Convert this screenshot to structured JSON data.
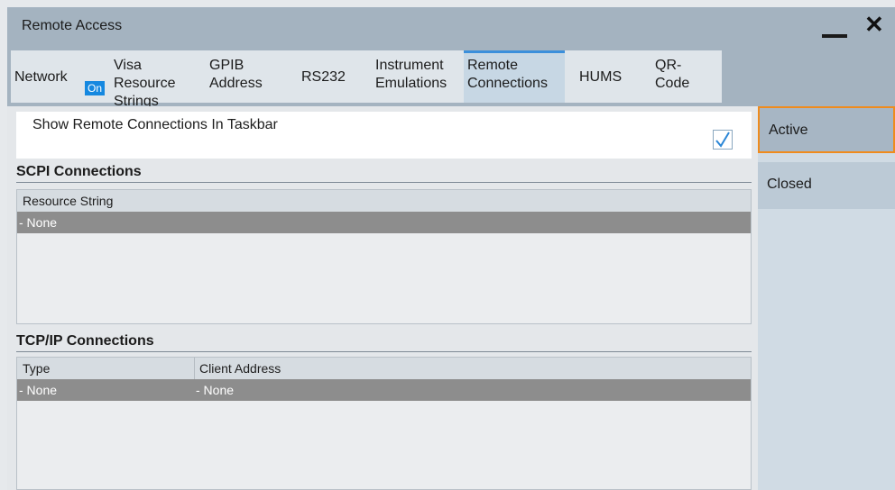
{
  "window": {
    "title": "Remote Access"
  },
  "tabs": [
    {
      "label": "Network",
      "badge": "On"
    },
    {
      "label": "Visa Resource\nStrings"
    },
    {
      "label": "GPIB\nAddress"
    },
    {
      "label": "RS232"
    },
    {
      "label": "Instrument\nEmulations"
    },
    {
      "label": "Remote\nConnections",
      "active": true
    },
    {
      "label": "HUMS"
    },
    {
      "label": "QR-\nCode"
    }
  ],
  "show_taskbar": {
    "label": "Show Remote Connections In Taskbar",
    "checked": true
  },
  "scpi": {
    "title": "SCPI Connections",
    "columns": [
      "Resource String"
    ],
    "rows": [
      [
        "- None"
      ]
    ]
  },
  "tcpip": {
    "title": "TCP/IP Connections",
    "columns": [
      "Type",
      "Client Address"
    ],
    "rows": [
      [
        "- None",
        "- None"
      ]
    ]
  },
  "side": {
    "active_label": "Active",
    "closed_label": "Closed",
    "selected": "Active"
  },
  "colors": {
    "accent": "#3b8fdb",
    "badge": "#1588e0",
    "focus": "#ef8b1d",
    "titlebar": "#a4b3c0"
  },
  "icons": {
    "minimize": "minimize-icon",
    "close": "close-icon",
    "check": "checkmark-icon"
  }
}
